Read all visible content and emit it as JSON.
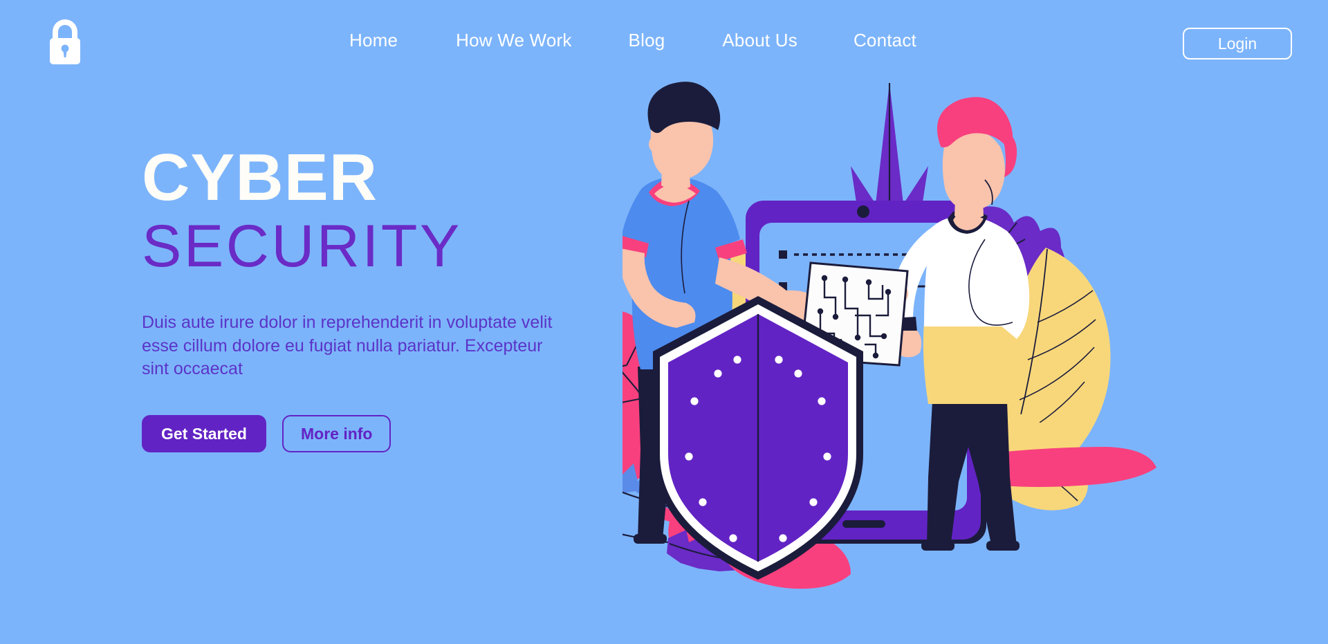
{
  "theme": {
    "background": "#7CB4FB",
    "accent_purple": "#6223C4",
    "title_white": "#FEFDF8",
    "title_purple": "#6A2BC6",
    "paragraph_purple": "#5B34C8",
    "leaf_pink": "#F8407E",
    "leaf_yellow": "#F8D77A",
    "leaf_blue": "#5B8BE8",
    "leaf_purple": "#6A2BC6",
    "skin": "#F9C3AC",
    "dark_navy": "#1B1C3B"
  },
  "navbar": {
    "logo_icon": "padlock-icon",
    "links": [
      {
        "label": "Home"
      },
      {
        "label": "How We Work"
      },
      {
        "label": "Blog"
      },
      {
        "label": "About Us"
      },
      {
        "label": "Contact"
      }
    ],
    "login_label": "Login"
  },
  "hero": {
    "title_line1": "CYBER",
    "title_line2": "SECURITY",
    "paragraph": "Duis aute irure dolor in reprehenderit in voluptate velit esse cillum dolore eu fugiat nulla pariatur. Excepteur sint occaecat",
    "primary_button": "Get Started",
    "secondary_button": "More info"
  },
  "illustration": {
    "name": "cyber-security-hero-illustration",
    "elements": [
      "foliage-pink-leaves",
      "foliage-yellow-leaves",
      "foliage-blue-fern",
      "foliage-purple-feather",
      "person-left-blue-shirt",
      "person-right-white-shirt",
      "purple-shield",
      "tablet-device",
      "circuit-board-sheet"
    ]
  }
}
